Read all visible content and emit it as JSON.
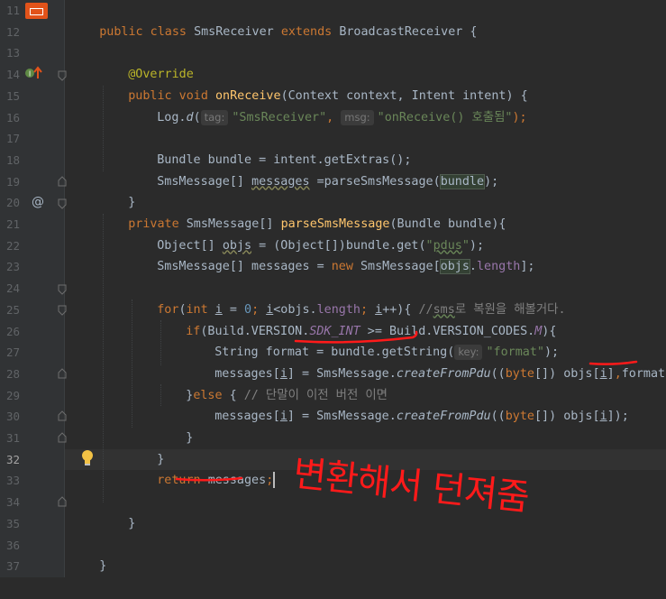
{
  "editor": {
    "active_line": "32",
    "lines": [
      {
        "num": "11"
      },
      {
        "num": "12"
      },
      {
        "num": "13"
      },
      {
        "num": "14"
      },
      {
        "num": "15"
      },
      {
        "num": "16"
      },
      {
        "num": "17"
      },
      {
        "num": "18"
      },
      {
        "num": "19"
      },
      {
        "num": "20"
      },
      {
        "num": "21"
      },
      {
        "num": "22"
      },
      {
        "num": "23"
      },
      {
        "num": "24"
      },
      {
        "num": "25"
      },
      {
        "num": "26"
      },
      {
        "num": "27"
      },
      {
        "num": "28"
      },
      {
        "num": "29"
      },
      {
        "num": "30"
      },
      {
        "num": "31"
      },
      {
        "num": "32"
      },
      {
        "num": "33"
      },
      {
        "num": "34"
      },
      {
        "num": "35"
      },
      {
        "num": "36"
      },
      {
        "num": "37"
      }
    ]
  },
  "code": {
    "l11": {
      "a": "public class ",
      "b": "SmsReceiver ",
      "c": "extends ",
      "d": "BroadcastReceiver {"
    },
    "l13": {
      "a": "@Override"
    },
    "l14": {
      "a": "public void ",
      "b": "onReceive",
      "c": "(Context context, Intent intent) {"
    },
    "l16": {
      "a": "Log.",
      "b": "d",
      "c": "(",
      "h1": "tag:",
      "s1": "\"SmsReceiver\"",
      ", ": ", ",
      "h2": "msg:",
      "s2": "\"onReceive() 호출됨\"",
      "e": ");"
    },
    "l17": {
      "a": "Bundle bundle = intent.getExtras();"
    },
    "l18": {
      "a": "SmsMessage[] ",
      "b": "messages",
      " c": " =",
      "c": " =parseSmsMessage(",
      "d": "bundle",
      "e": ");"
    },
    "l19": {
      "a": "}"
    },
    "l20": {
      "a": "private ",
      "b": "SmsMessage[] ",
      "c": "parseSmsMessage",
      "d": "(Bundle bundle){"
    },
    "l21": {
      "a": "Object[] ",
      "b": "objs",
      " c": "",
      "c": " = (Object[])bundle.get(",
      "s": "\"",
      "s2": "pdus",
      "s3": "\"",
      "e": ");"
    },
    "l22": {
      "a": "SmsMessage[] messages = ",
      "b": "new ",
      "c": "SmsMessage[",
      "d": "objs",
      "e": ".",
      "f": "length",
      "g": "];"
    },
    "l24": {
      "a": "for",
      "b": "(",
      "c": "int ",
      "d": "i",
      " e": "",
      "e": " = ",
      "n": "0",
      "f": "; ",
      "g": "i",
      "h": "<objs.",
      "i": "length",
      "j": "; ",
      "k": "i",
      "l": "++){ ",
      "cm": "//",
      "cm2": "sms",
      "cm3": "로 복원을 해볼거다."
    },
    "l25": {
      "a": "if",
      "b": "(Build.VERSION.",
      "c": "SDK_INT",
      " d": "",
      "d": " >= Build.VERSION_CODES.",
      "e": "M",
      "f": "){"
    },
    "l26": {
      "a": "String format = ",
      "b": "bundle.getString(",
      "h": "key:",
      "s": "\"format\"",
      "e": ");"
    },
    "l27": {
      "a": "messages[",
      "b": "i",
      "c": "] = SmsMessage.",
      "d": "createFromPdu",
      "e": "((",
      "f": "byte",
      "g": "[]) objs[",
      "h": "i",
      "i": "]",
      "j": ",",
      "k": "format",
      "l": ");"
    },
    "l28": {
      "a": "}",
      "b": "else ",
      "c": "{ ",
      "cm": "// 단말이 이전 버전 이면"
    },
    "l29": {
      "a": "messages[",
      "b": "i",
      "c": "] = SmsMessage.",
      "d": "createFromPdu",
      "e": "((",
      "f": "byte",
      "g": "[]) objs[",
      "h": "i",
      "i": "]);"
    },
    "l30": {
      "a": "}"
    },
    "l31": {
      "a": "}"
    },
    "l32": {
      "a": "return ",
      "b": "messages",
      ";": ";"
    },
    "l34": {
      "a": "}"
    },
    "l36": {
      "a": "}"
    }
  },
  "annotation": {
    "handwritten_text": "변환해서 던져줌",
    "color": "#ff0000"
  },
  "icons": {
    "file_icon": "java-file-icon",
    "override": "override-method-icon",
    "implements": "at-annotation-icon",
    "bulb": "lightbulb-icon"
  },
  "colors": {
    "background": "#2b2b2b",
    "gutter": "#313335",
    "keyword": "#cc7832",
    "string": "#6a8759",
    "method": "#ffc66d",
    "field": "#9876aa",
    "number": "#6897bb",
    "annotation": "#bbb529",
    "comment": "#808080"
  }
}
